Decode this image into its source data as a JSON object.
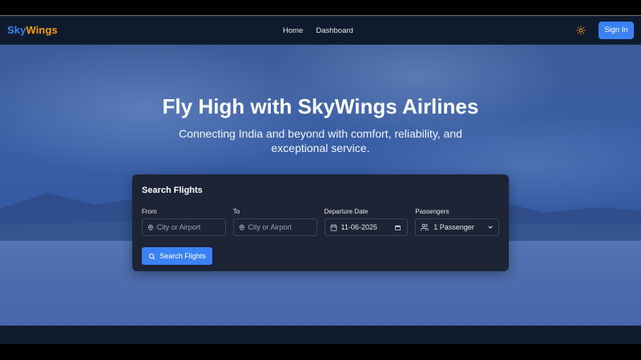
{
  "brand": {
    "part1": "Sky",
    "part2": "Wings"
  },
  "nav": {
    "links": [
      {
        "label": "Home"
      },
      {
        "label": "Dashboard"
      }
    ]
  },
  "header": {
    "theme_icon": "sun-icon",
    "signin_label": "Sign In"
  },
  "hero": {
    "title": "Fly High with SkyWings Airlines",
    "subtitle": "Connecting India and beyond with comfort, reliability, and exceptional service."
  },
  "search": {
    "title": "Search Flights",
    "from": {
      "label": "From",
      "placeholder": "City or Airport",
      "icon": "map-pin-icon"
    },
    "to": {
      "label": "To",
      "placeholder": "City or Airport",
      "icon": "map-pin-icon"
    },
    "departure": {
      "label": "Departure Date",
      "value": "11-06-2025",
      "icon": "calendar-icon"
    },
    "passengers": {
      "label": "Passengers",
      "value": "1 Passenger",
      "icon": "users-icon"
    },
    "button_label": "Search Flights",
    "button_icon": "search-icon"
  },
  "colors": {
    "primary": "#3b82f6",
    "brand_accent": "#f59e0b",
    "navbar_bg": "#0f1b2d",
    "card_bg": "#1c2435"
  }
}
